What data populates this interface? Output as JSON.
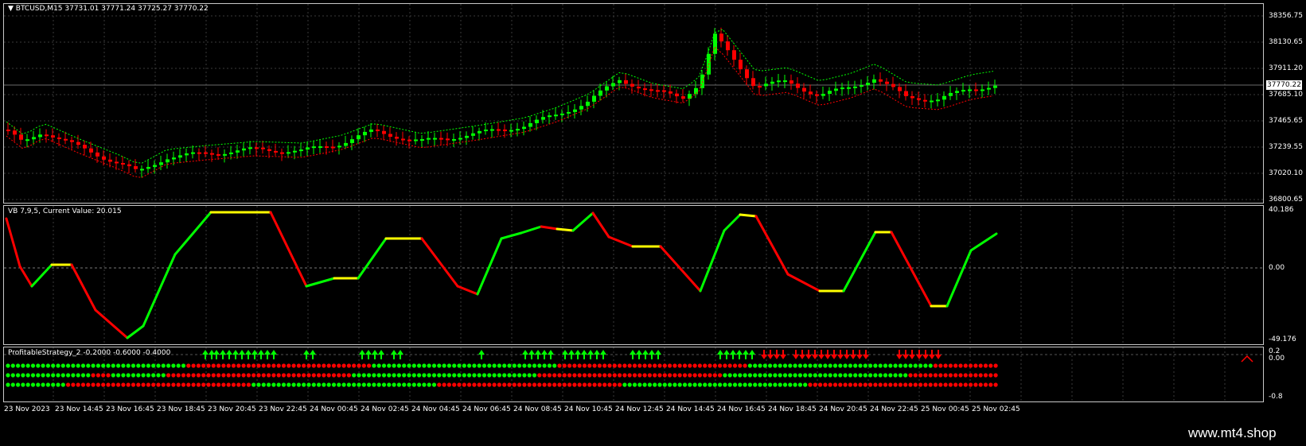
{
  "main": {
    "title": "▼ BTCUSD,M15  37731.01 37771.24 37725.27 37770.22",
    "price_labels": [
      "38356.75",
      "38130.65",
      "37911.20",
      "37685.10",
      "37465.65",
      "37239.55",
      "37020.10",
      "36800.65"
    ],
    "current_price": "37770.22"
  },
  "vb": {
    "title": "VB 7,9,5, Current Value: 20.015",
    "labels": [
      "40.186",
      "0.00",
      "-49.176"
    ]
  },
  "ps": {
    "title": "ProfitableStrategy_2 -0.2000 -0.6000 -0.4000",
    "labels": [
      "0.2",
      "0.00",
      "-0.8"
    ]
  },
  "time_labels": [
    "23 Nov 2023",
    "23 Nov 14:45",
    "23 Nov 16:45",
    "23 Nov 18:45",
    "23 Nov 20:45",
    "23 Nov 22:45",
    "24 Nov 00:45",
    "24 Nov 02:45",
    "24 Nov 04:45",
    "24 Nov 06:45",
    "24 Nov 08:45",
    "24 Nov 10:45",
    "24 Nov 12:45",
    "24 Nov 14:45",
    "24 Nov 16:45",
    "24 Nov 18:45",
    "24 Nov 20:45",
    "24 Nov 22:45",
    "25 Nov 00:45",
    "25 Nov 02:45"
  ],
  "watermark": "www.mt4.shop",
  "colors": {
    "bull": "#00ff00",
    "bear": "#ff0000",
    "flat": "#ffff00",
    "grid": "#3a3a3a",
    "background": "#000000",
    "text": "#ffffff"
  }
}
